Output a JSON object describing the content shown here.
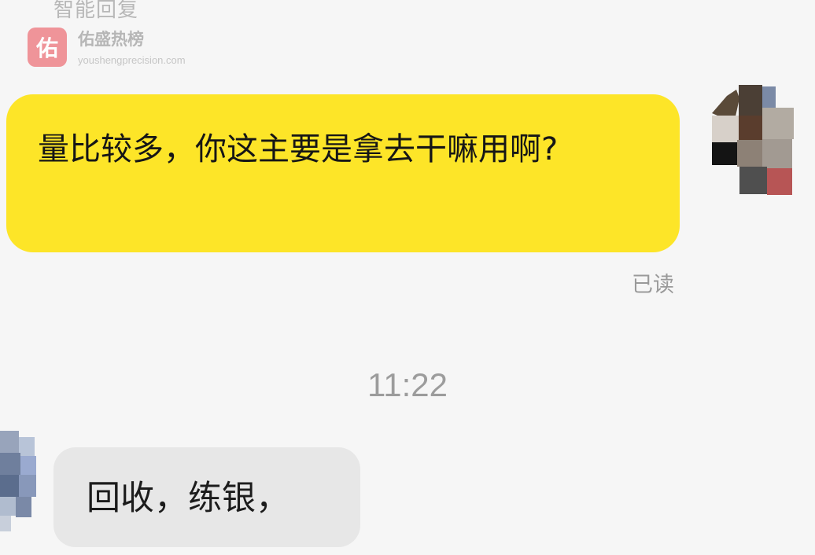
{
  "top_label": "智能回复",
  "watermark": {
    "badge": "佑",
    "title": "佑盛热榜",
    "url": "youshengprecision.com"
  },
  "messages": [
    {
      "direction": "outgoing",
      "text": "量比较多，你这主要是拿去干嘛用啊?",
      "status": "已读"
    },
    {
      "direction": "incoming",
      "text": "回收，练银，"
    }
  ],
  "timestamp": "11:22",
  "colors": {
    "outgoing_bubble": "#fde528",
    "incoming_bubble": "#e7e7e7",
    "background": "#f6f6f6",
    "watermark_badge": "#ef8f95"
  },
  "icons": {
    "right_avatar": "pixelated-avatar",
    "left_avatar": "pixelated-avatar"
  }
}
